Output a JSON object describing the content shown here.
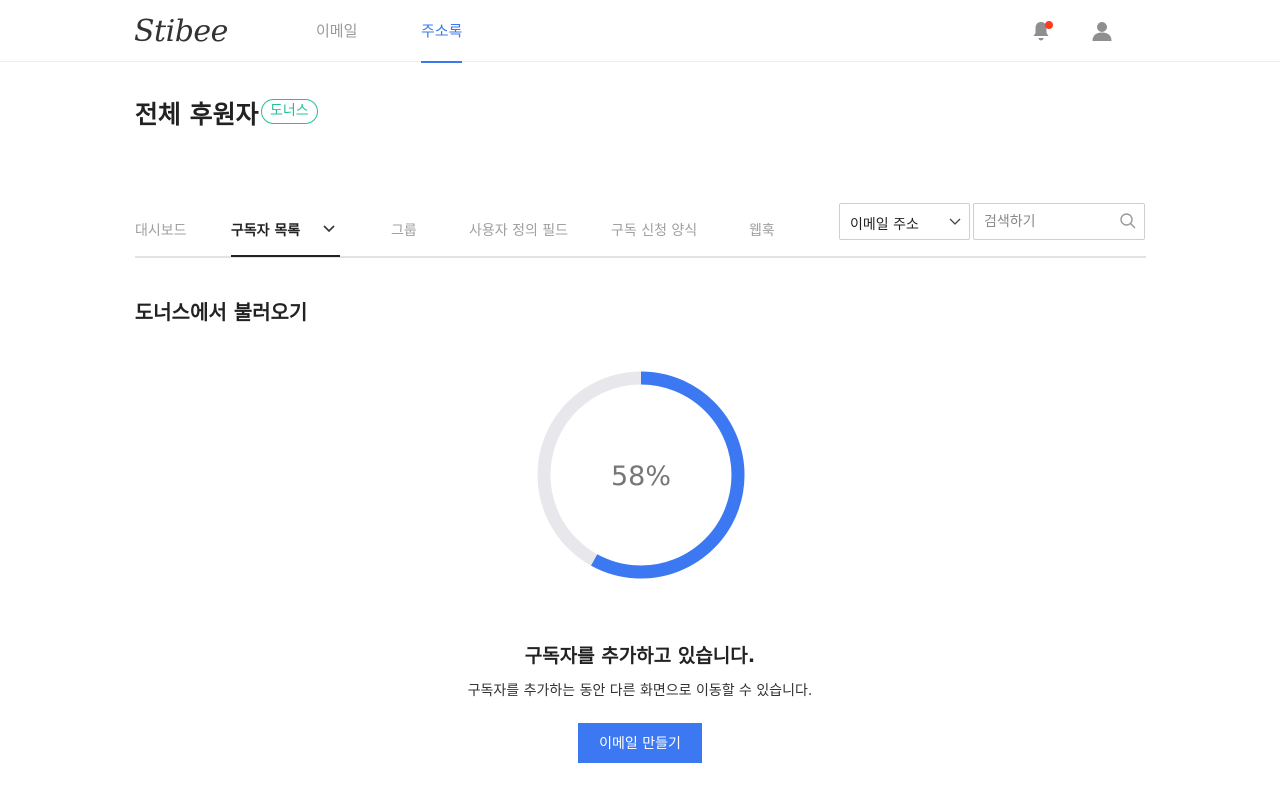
{
  "header": {
    "logo": "Stibee",
    "nav": [
      {
        "label": "이메일",
        "active": false
      },
      {
        "label": "주소록",
        "active": true
      }
    ],
    "notification_dot_color": "#ff3b1f",
    "icons": [
      "bell-icon",
      "user-icon"
    ]
  },
  "page": {
    "title": "전체 후원자",
    "badge": "도너스"
  },
  "tabs": [
    {
      "label": "대시보드",
      "active": false
    },
    {
      "label": "구독자 목록",
      "active": true
    },
    {
      "label": "그룹",
      "active": false
    },
    {
      "label": "사용자 정의 필드",
      "active": false
    },
    {
      "label": "구독 신청 양식",
      "active": false
    },
    {
      "label": "웹훅",
      "active": false
    }
  ],
  "search": {
    "field_select": "이메일 주소",
    "placeholder": "검색하기"
  },
  "section": {
    "title": "도너스에서 불러오기"
  },
  "progress": {
    "value": 0.58,
    "label": "58%",
    "color": "#3b78f2",
    "track_color": "#e8e8ec"
  },
  "status": {
    "title": "구독자를 추가하고 있습니다.",
    "description": "구독자를 추가하는 동안 다른 화면으로 이동할 수 있습니다.",
    "button": "이메일 만들기"
  },
  "colors": {
    "accent": "#3b78f2",
    "badge": "#21c198"
  }
}
